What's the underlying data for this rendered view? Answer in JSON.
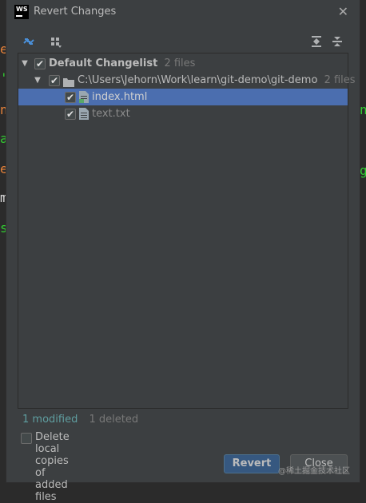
{
  "background_editor": {
    "left_chars": [
      "e",
      "'",
      "n",
      "a",
      "e",
      "m",
      "s"
    ],
    "right_chars": [
      "n",
      "g"
    ]
  },
  "dialog": {
    "app_icon": "WS",
    "title": "Revert Changes",
    "close_icon": "close-icon"
  },
  "toolbar": {
    "left_icons": [
      "group-by-icon",
      "show-diff-icon"
    ],
    "right_icons": [
      "expand-all-icon",
      "collapse-all-icon"
    ]
  },
  "tree": {
    "changelist": {
      "label": "Default Changelist",
      "count": "2 files"
    },
    "folder": {
      "label": "C:\\Users\\Jehorn\\Work\\learn\\git-demo\\git-demo",
      "count": "2 files"
    },
    "files": [
      {
        "label": "index.html",
        "selected": true,
        "icon": "html-file-icon"
      },
      {
        "label": "text.txt",
        "selected": false,
        "icon": "text-file-icon"
      }
    ]
  },
  "status": {
    "modified": "1 modified",
    "deleted": "1 deleted"
  },
  "options": {
    "delete_local_label": "Delete local copies of added files"
  },
  "buttons": {
    "revert": "Revert",
    "close": "Close"
  },
  "watermark": "@稀土掘金技术社区",
  "colors": {
    "dialog_bg": "#3c3f41",
    "selection": "#4b6eaf",
    "primary_button": "#365880",
    "modified_text": "#5f9ea0"
  }
}
